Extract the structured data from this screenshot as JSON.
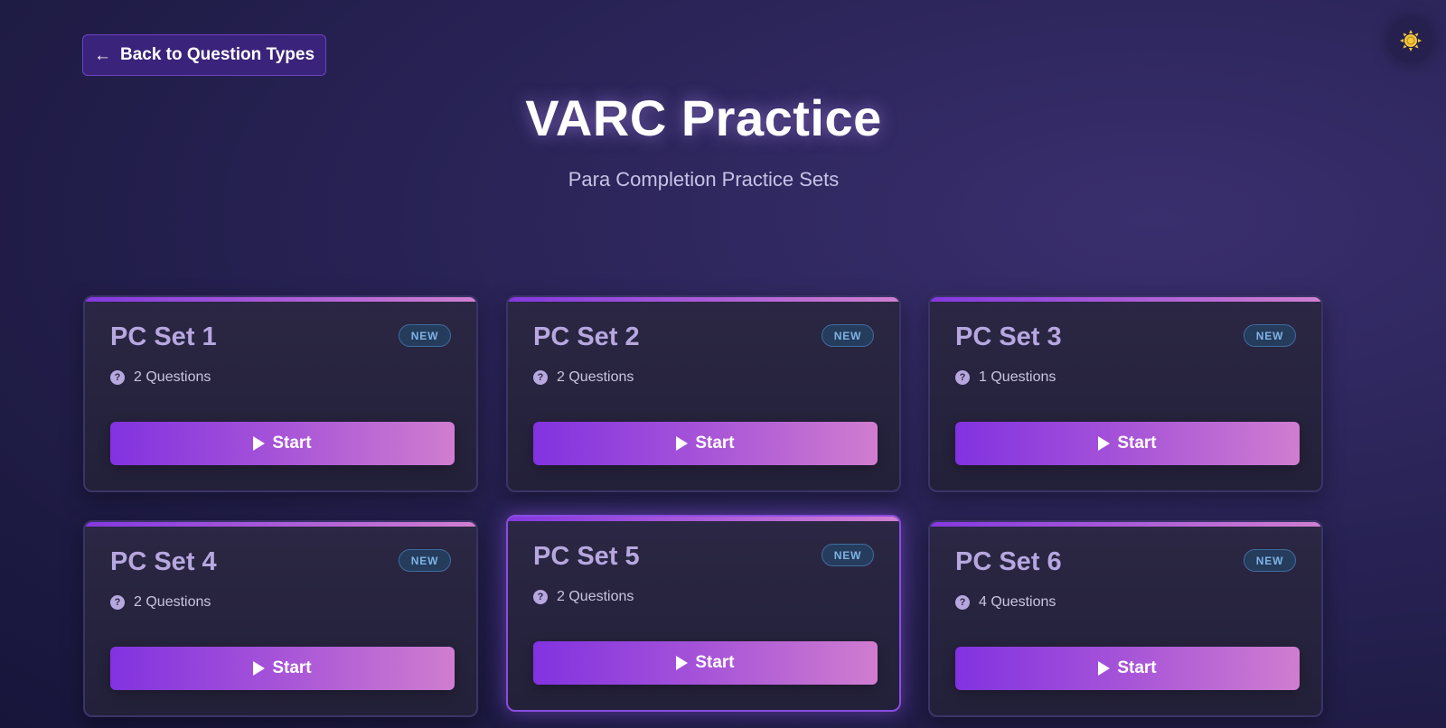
{
  "header": {
    "back_label": "Back to Question Types",
    "title": "VARC Practice",
    "subtitle": "Para Completion Practice Sets",
    "theme_icon": "sun-icon"
  },
  "colors": {
    "accent_start": "#8232e0",
    "accent_end": "#d07dd0",
    "badge_text": "#7fb3e5",
    "theme_icon": "#f5c842"
  },
  "sets": [
    {
      "title": "PC Set 1",
      "badge": "NEW",
      "questions": "2 Questions",
      "start_label": "Start"
    },
    {
      "title": "PC Set 2",
      "badge": "NEW",
      "questions": "2 Questions",
      "start_label": "Start"
    },
    {
      "title": "PC Set 3",
      "badge": "NEW",
      "questions": "1 Questions",
      "start_label": "Start"
    },
    {
      "title": "PC Set 4",
      "badge": "NEW",
      "questions": "2 Questions",
      "start_label": "Start"
    },
    {
      "title": "PC Set 5",
      "badge": "NEW",
      "questions": "2 Questions",
      "start_label": "Start"
    },
    {
      "title": "PC Set 6",
      "badge": "NEW",
      "questions": "4 Questions",
      "start_label": "Start"
    }
  ]
}
